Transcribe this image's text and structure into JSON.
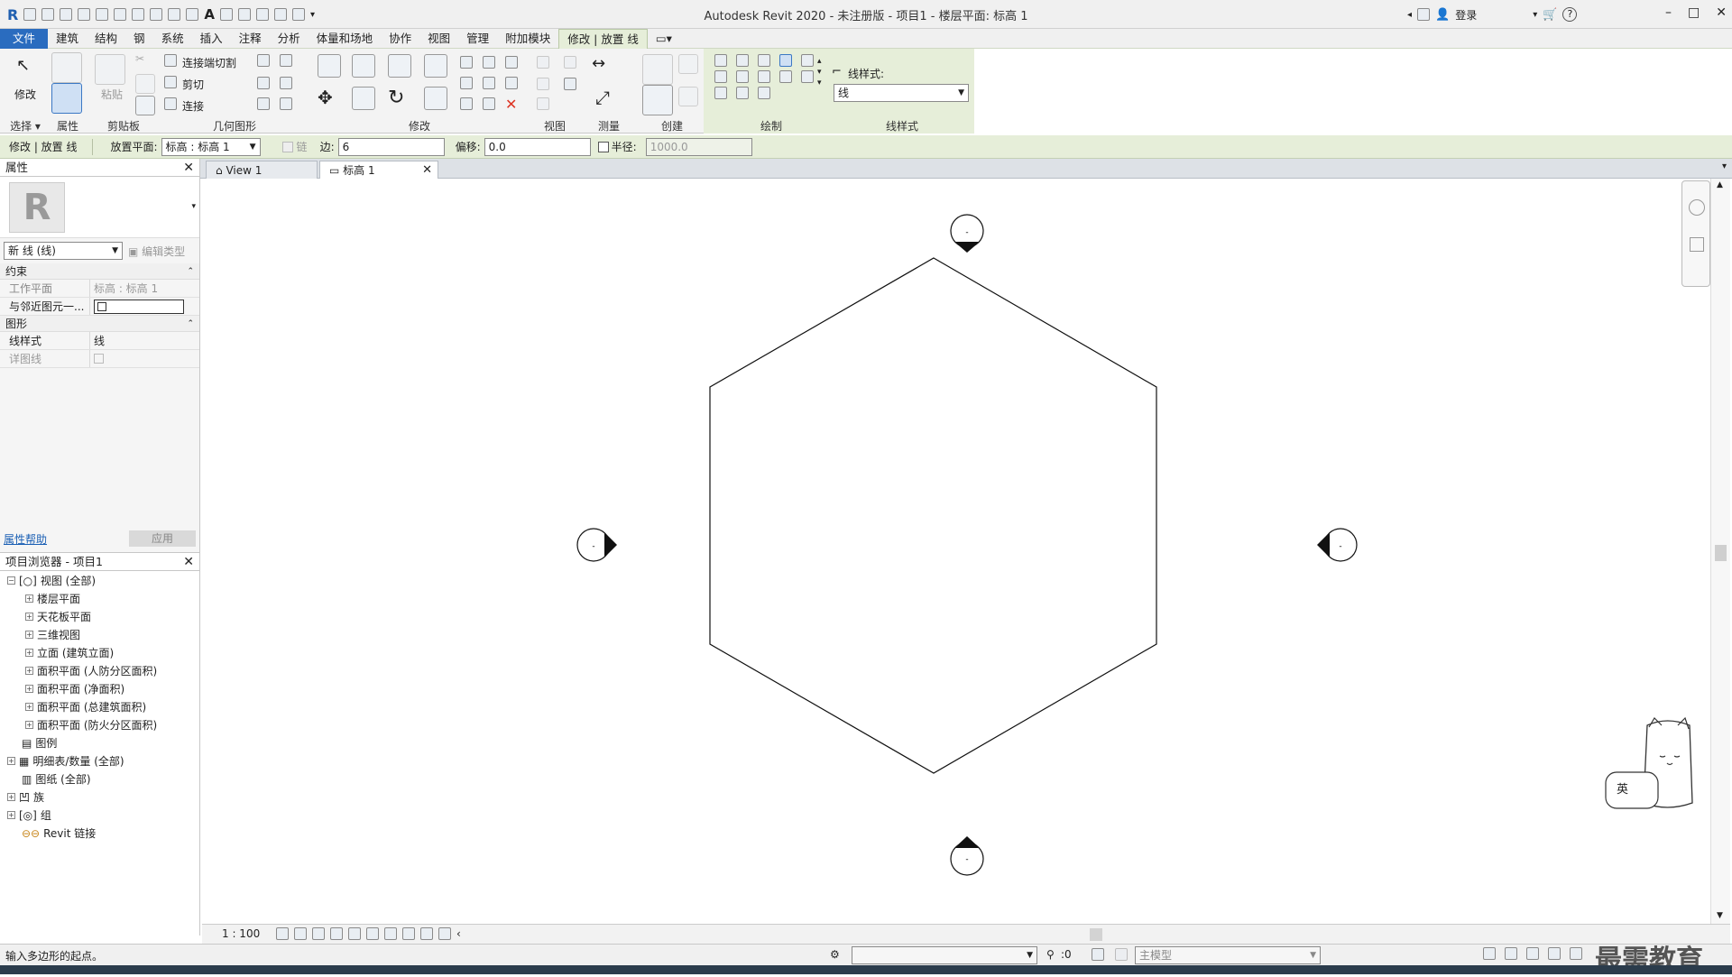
{
  "window": {
    "title": "Autodesk Revit 2020 - 未注册版 - 项目1 - 楼层平面: 标高 1",
    "login_label": "登录",
    "help_label": "?"
  },
  "menu": {
    "items": [
      "文件",
      "建筑",
      "结构",
      "钢",
      "系统",
      "插入",
      "注释",
      "分析",
      "体量和场地",
      "协作",
      "视图",
      "管理",
      "附加模块",
      "修改 | 放置 线"
    ]
  },
  "ribbon": {
    "panels": {
      "select": "选择",
      "properties": "属性",
      "clipboard": "剪贴板",
      "geometry": "几何图形",
      "modify": "修改",
      "view": "视图",
      "measure": "测量",
      "create": "创建",
      "draw": "绘制",
      "linestyle": "线样式"
    },
    "modify_label": "修改",
    "paste_label": "粘贴",
    "join_cut_label": "连接端切割",
    "cut_label": "剪切",
    "join_label": "连接",
    "linestyle_title": "线样式:",
    "linestyle_value": "线"
  },
  "options_bar": {
    "context": "修改 | 放置 线",
    "placement_plane_label": "放置平面:",
    "placement_plane_value": "标高 : 标高 1",
    "chain_label": "链",
    "sides_label": "边:",
    "sides_value": "6",
    "offset_label": "偏移:",
    "offset_value": "0.0",
    "radius_label": "半径:",
    "radius_value": "1000.0"
  },
  "properties": {
    "title": "属性",
    "type_selector": "新 线 (线)",
    "edit_type": "编辑类型",
    "sections": [
      {
        "name": "约束",
        "rows": [
          {
            "k": "工作平面",
            "v": "标高 : 标高 1"
          },
          {
            "k": "与邻近图元一...",
            "v": ""
          }
        ]
      },
      {
        "name": "图形",
        "rows": [
          {
            "k": "线样式",
            "v": "线"
          },
          {
            "k": "详图线",
            "v": ""
          }
        ]
      }
    ],
    "help_link": "属性帮助",
    "apply_button": "应用"
  },
  "browser": {
    "title": "项目浏览器 - 项目1",
    "items": [
      {
        "label": "视图 (全部)",
        "level": 0,
        "icon": "views-icon"
      },
      {
        "label": "楼层平面",
        "level": 1
      },
      {
        "label": "天花板平面",
        "level": 1
      },
      {
        "label": "三维视图",
        "level": 1
      },
      {
        "label": "立面 (建筑立面)",
        "level": 1
      },
      {
        "label": "面积平面 (人防分区面积)",
        "level": 1
      },
      {
        "label": "面积平面 (净面积)",
        "level": 1
      },
      {
        "label": "面积平面 (总建筑面积)",
        "level": 1
      },
      {
        "label": "面积平面 (防火分区面积)",
        "level": 1
      },
      {
        "label": "图例",
        "level": 0,
        "icon": "legend-icon"
      },
      {
        "label": "明细表/数量 (全部)",
        "level": 0,
        "icon": "schedule-icon"
      },
      {
        "label": "图纸 (全部)",
        "level": 0,
        "icon": "sheet-icon"
      },
      {
        "label": "族",
        "level": 0,
        "icon": "family-icon"
      },
      {
        "label": "组",
        "level": 0,
        "icon": "group-icon"
      },
      {
        "label": "Revit 链接",
        "level": 0,
        "icon": "link-icon"
      }
    ]
  },
  "tabs": [
    {
      "label": "View 1",
      "active": false
    },
    {
      "label": "标高 1",
      "active": true
    }
  ],
  "view_controls": {
    "scale": "1 : 100"
  },
  "status": {
    "message": "输入多边形的起点。",
    "filter_count": ":0",
    "model_label": "主模型"
  },
  "watermark": "最需教育",
  "ime_label": "英"
}
